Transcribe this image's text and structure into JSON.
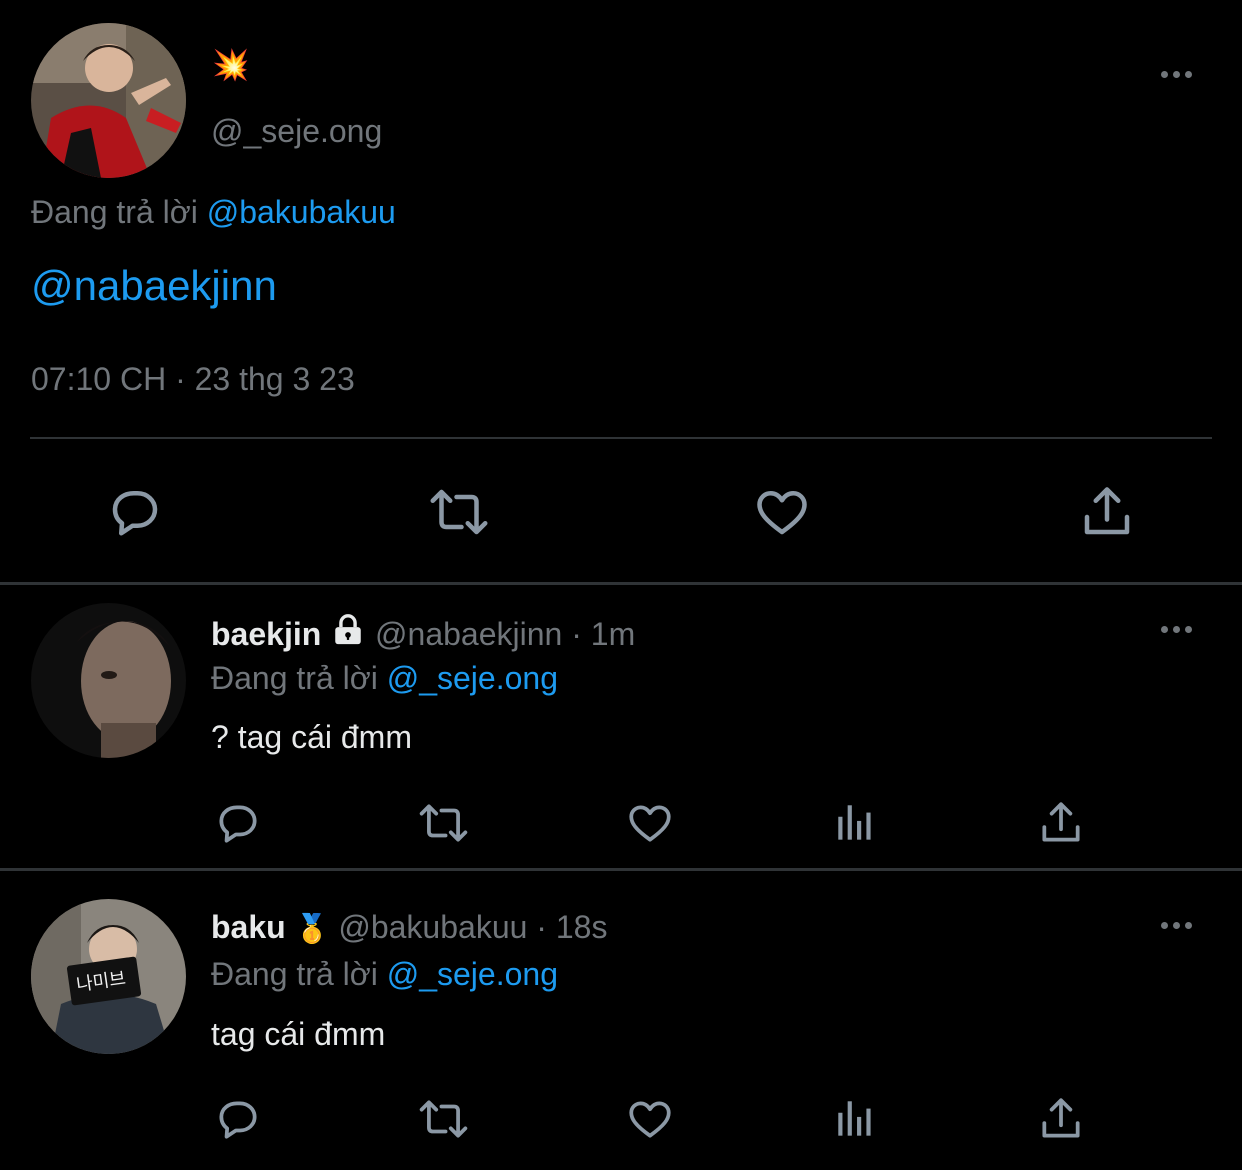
{
  "main_tweet": {
    "display_name_emoji": "💥",
    "handle": "@_seje.ong",
    "replying_label": "Đang trả lời",
    "replying_to": "@bakubakuu",
    "content_mention": "@nabaekjinn",
    "timestamp": "07:10 CH · 23 thg 3 23",
    "actions": [
      "reply-icon",
      "retweet-icon",
      "like-icon",
      "share-icon"
    ]
  },
  "replies": [
    {
      "name": "baekjin",
      "badge": "lock-icon",
      "handle": "@nabaekjinn",
      "time": "· 1m",
      "replying_label": "Đang trả lời",
      "replying_to": "@_seje.ong",
      "content": "? tag cái đmm"
    },
    {
      "name": "baku",
      "badge_emoji": "🥇",
      "handle": "@bakubakuu",
      "time": "· 18s",
      "replying_label": "Đang trả lời",
      "replying_to": "@_seje.ong",
      "content": "tag cái đmm",
      "avatar_sign_text": "나미브"
    }
  ],
  "colors": {
    "background": "#000000",
    "text": "#e7e9ea",
    "muted": "#71767b",
    "link": "#1d9bf0",
    "divider": "#2f3336"
  }
}
